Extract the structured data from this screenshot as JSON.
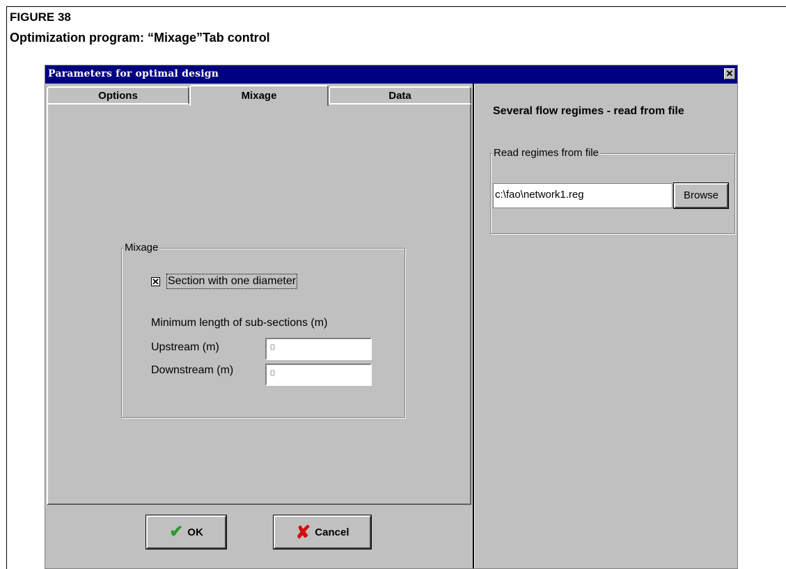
{
  "figure": {
    "label": "FIGURE 38",
    "caption": "Optimization program: “Mixage”Tab control"
  },
  "window": {
    "title": "Parameters for optimal design",
    "close_glyph": "✕"
  },
  "tabs": {
    "options": "Options",
    "mixage": "Mixage",
    "data": "Data",
    "active": "Mixage"
  },
  "mixage_group": {
    "legend": "Mixage",
    "checkbox_label": "Section with one diameter",
    "checkbox_checked": true,
    "checkbox_glyph": "✕",
    "min_length_label": "Minimum length of sub-sections (m)",
    "upstream_label": "Upstream (m)",
    "upstream_value": "0",
    "downstream_label": "Downstream (m)",
    "downstream_value": "0"
  },
  "buttons": {
    "ok_label": "OK",
    "ok_icon": "checkmark-icon",
    "cancel_label": "Cancel",
    "cancel_icon": "x-icon"
  },
  "right_pane": {
    "title": "Several flow regimes - read from file",
    "group_legend": "Read regimes from file",
    "file_path": "c:\\fao\\network1.reg",
    "browse_label": "Browse"
  },
  "colors": {
    "titlebar": "#000080",
    "face": "#c0c0c0",
    "ok_icon": "#2e9a2e",
    "cancel_icon": "#d01010"
  }
}
